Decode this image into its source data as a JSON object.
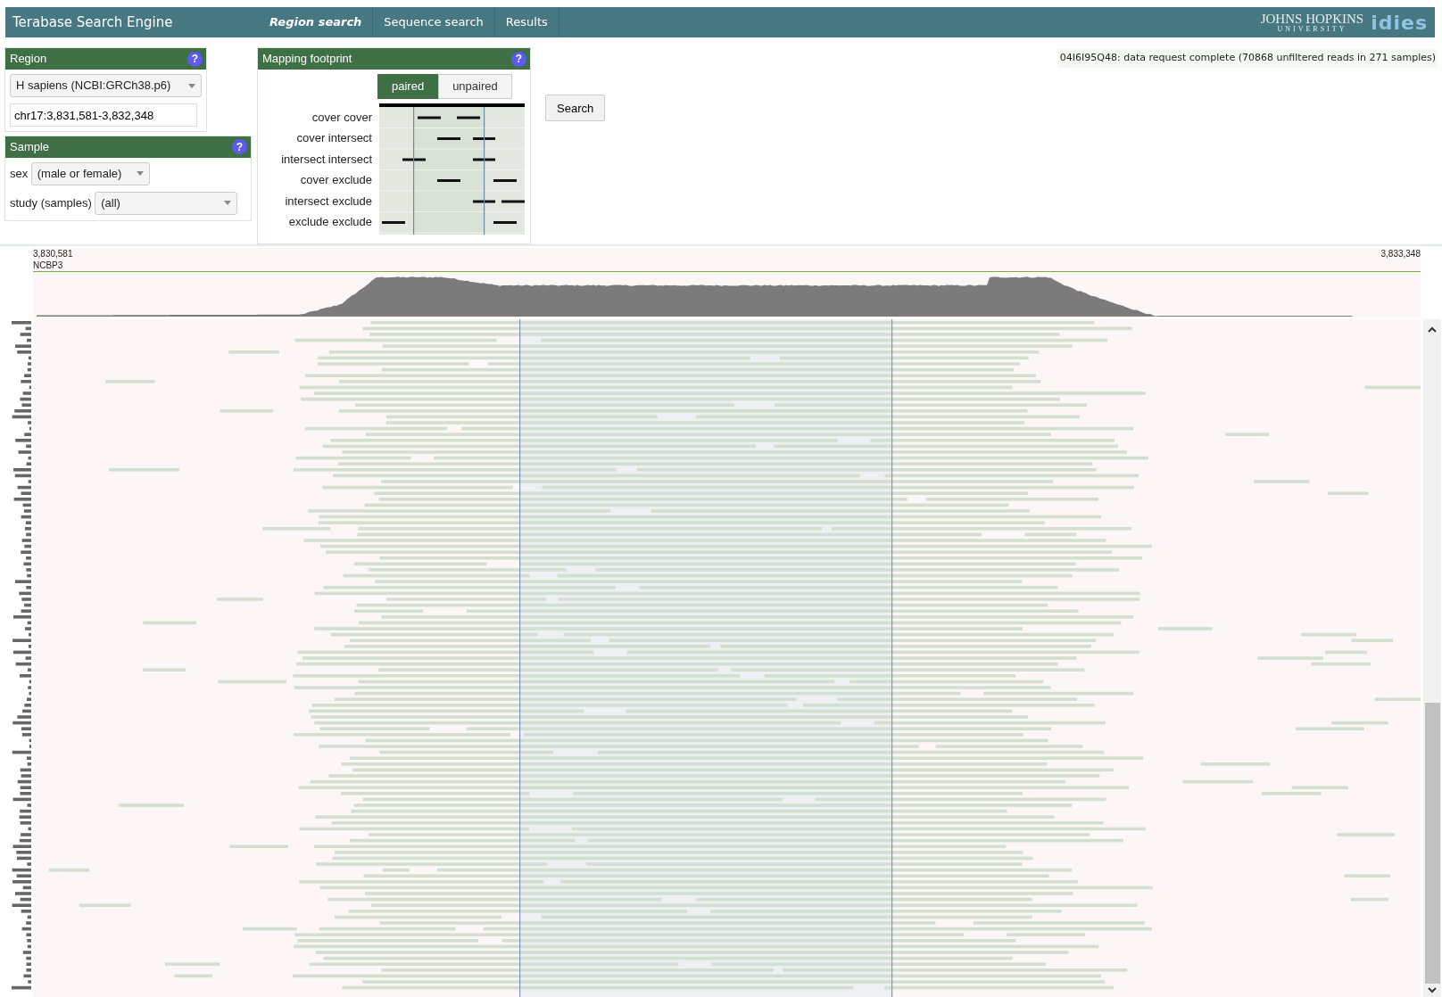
{
  "header": {
    "title": "Terabase Search Engine",
    "tabs": [
      {
        "label": "Region search",
        "selected": true
      },
      {
        "label": "Sequence search",
        "selected": false
      },
      {
        "label": "Results",
        "selected": false
      }
    ],
    "logo": {
      "line1": "JOHNS HOPKINS",
      "line2": "UNIVERSITY",
      "mark": "idies"
    }
  },
  "region": {
    "title": "Region",
    "help": "?",
    "genome": "H sapiens (NCBI:GRCh38.p6)",
    "locus": "chr17:3,831,581-3,832,348"
  },
  "sample": {
    "title": "Sample",
    "help": "?",
    "filters": [
      {
        "label": "sex",
        "value": "(male or female)"
      },
      {
        "label": "study (samples)",
        "value": "(all)"
      }
    ]
  },
  "footprint": {
    "title": "Mapping footprint",
    "help": "?",
    "modes": [
      {
        "label": "paired",
        "selected": true
      },
      {
        "label": "unpaired",
        "selected": false
      }
    ],
    "rows": [
      {
        "label": "cover cover"
      },
      {
        "label": "cover intersect"
      },
      {
        "label": "intersect intersect"
      },
      {
        "label": "cover exclude"
      },
      {
        "label": "intersect exclude"
      },
      {
        "label": "exclude exclude"
      }
    ]
  },
  "search_button": "Search",
  "status": "04I6I95Q48: data request complete (70868 unfiltered reads in 271 samples)",
  "track": {
    "start": "3,830,581",
    "gene": "NCBP3",
    "end": "3,833,348"
  }
}
